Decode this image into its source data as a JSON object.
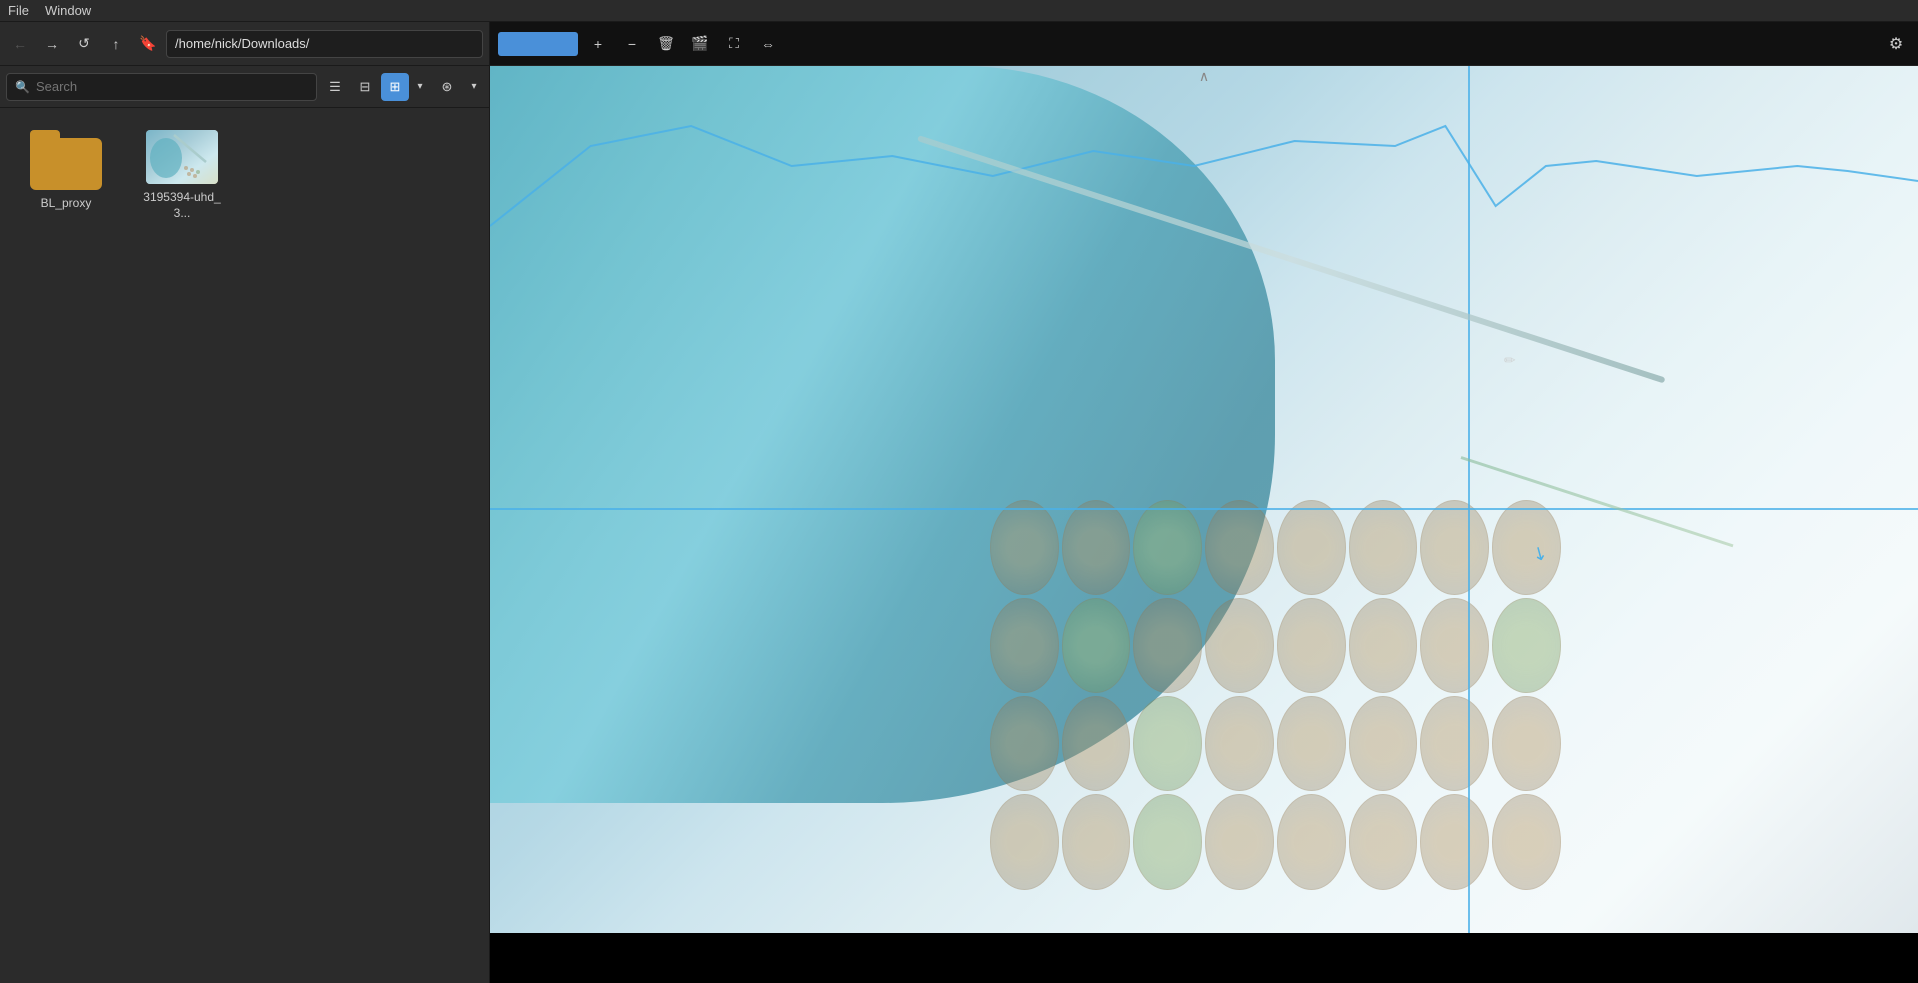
{
  "menu": {
    "items": [
      "File",
      "Window"
    ]
  },
  "nav": {
    "back_label": "←",
    "forward_label": "→",
    "refresh_label": "↺",
    "up_label": "↑",
    "bookmark_label": "🔖",
    "path": "/home/nick/Downloads/"
  },
  "search": {
    "placeholder": "Search",
    "value": ""
  },
  "view_modes": {
    "list_label": "☰",
    "compact_label": "⊟",
    "grid_label": "⊞",
    "dropdown_label": "▾"
  },
  "filter": {
    "label": "⊛",
    "dropdown_label": "▾"
  },
  "files": [
    {
      "name": "BL_proxy",
      "type": "folder",
      "label": "BL_proxy"
    },
    {
      "name": "3195394-uhd_3...",
      "type": "video",
      "label": "3195394-uhd_3..."
    }
  ],
  "viewer": {
    "toolbar": {
      "blue_btn_label": "",
      "plus_label": "+",
      "minus_label": "−",
      "trash_label": "🗑",
      "film_label": "🎬",
      "fullscreen_label": "⛶",
      "exchange_label": "⇔",
      "settings_label": "⚙"
    },
    "collapse_label": "∧"
  }
}
